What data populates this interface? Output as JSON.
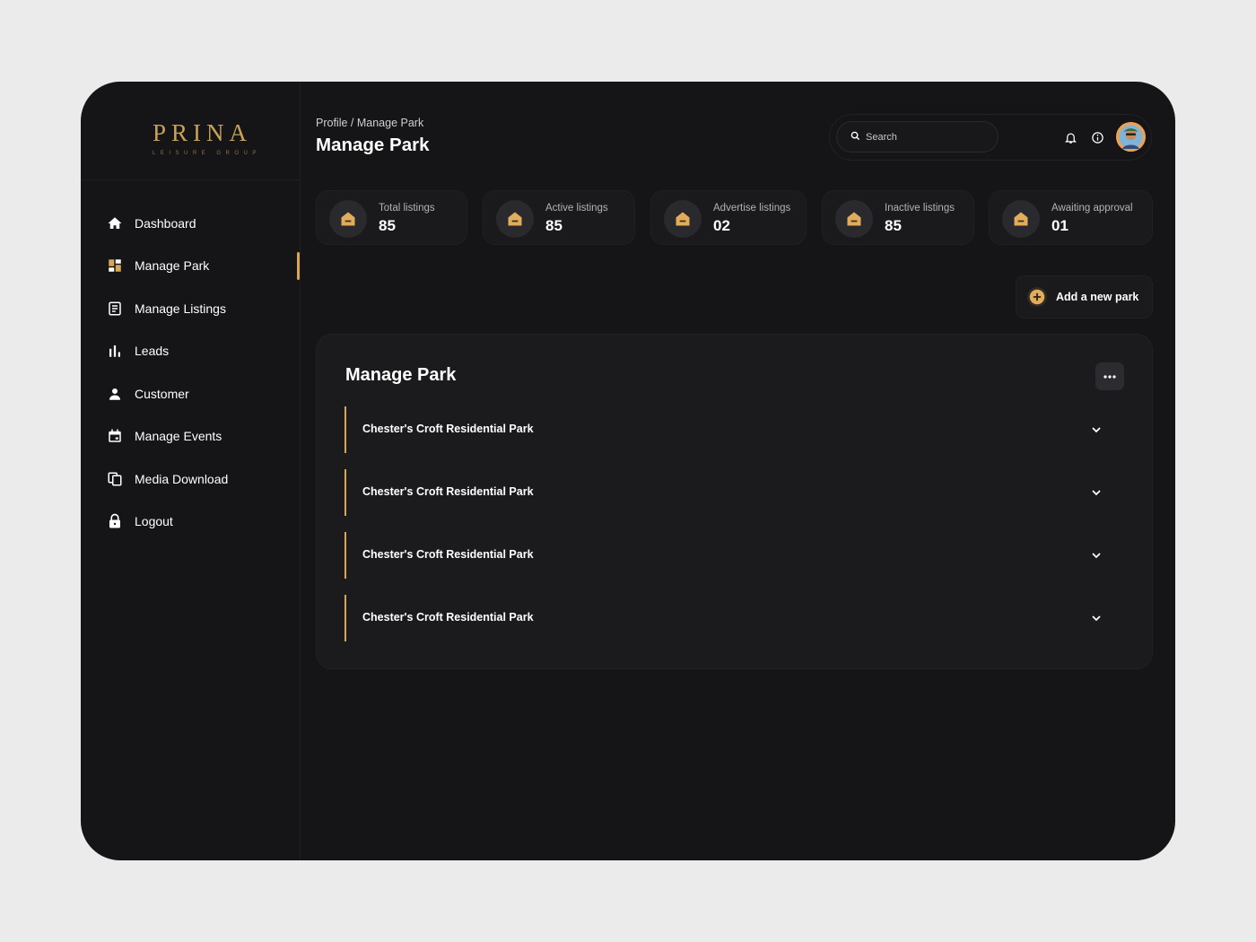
{
  "brand": {
    "name": "PRINA",
    "tagline": "LEISURE GROUP"
  },
  "sidebar": {
    "items": [
      {
        "label": "Dashboard",
        "icon": "home-icon"
      },
      {
        "label": "Manage Park",
        "icon": "grid-icon",
        "active": true
      },
      {
        "label": "Manage Listings",
        "icon": "list-icon"
      },
      {
        "label": "Leads",
        "icon": "bar-chart-icon"
      },
      {
        "label": "Customer",
        "icon": "user-icon"
      },
      {
        "label": "Manage Events",
        "icon": "calendar-icon"
      },
      {
        "label": "Media Download",
        "icon": "copy-icon"
      },
      {
        "label": "Logout",
        "icon": "lock-icon"
      }
    ]
  },
  "header": {
    "breadcrumb": "Profile / Manage Park",
    "title": "Manage Park",
    "search_placeholder": "Search"
  },
  "stats": [
    {
      "label": "Total listings",
      "value": "85"
    },
    {
      "label": "Active listings",
      "value": "85"
    },
    {
      "label": "Advertise listings",
      "value": "02"
    },
    {
      "label": "Inactive listings",
      "value": "85"
    },
    {
      "label": "Awaiting approval",
      "value": "01"
    }
  ],
  "add_button_label": "Add a new park",
  "panel": {
    "title": "Manage Park",
    "parks": [
      "Chester's Croft Residential Park",
      "Chester's Croft Residential Park",
      "Chester's Croft Residential Park",
      "Chester's Croft Residential Park"
    ]
  },
  "colors": {
    "accent": "#d8a755",
    "background": "#151416",
    "card": "#1a191c"
  }
}
